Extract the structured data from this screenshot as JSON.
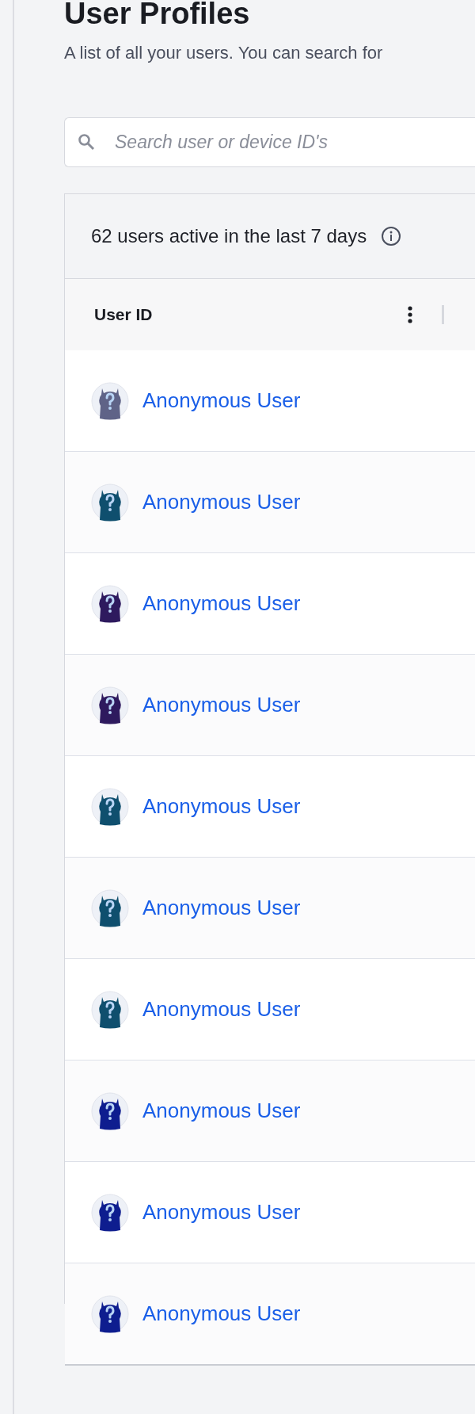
{
  "page": {
    "title": "User Profiles",
    "subtitle": "A list of all your users. You can search for"
  },
  "search": {
    "placeholder": "Search user or device ID's"
  },
  "table": {
    "summary": "62 users active in the last 7 days",
    "columns": [
      "User ID"
    ],
    "rows": [
      {
        "name": "Anonymous User",
        "color": "#5f6387"
      },
      {
        "name": "Anonymous User",
        "color": "#0f4f6e"
      },
      {
        "name": "Anonymous User",
        "color": "#2e1a5e"
      },
      {
        "name": "Anonymous User",
        "color": "#2e1a5e"
      },
      {
        "name": "Anonymous User",
        "color": "#0f4f6e"
      },
      {
        "name": "Anonymous User",
        "color": "#0f4f6e"
      },
      {
        "name": "Anonymous User",
        "color": "#0f4f6e"
      },
      {
        "name": "Anonymous User",
        "color": "#0e1d8f"
      },
      {
        "name": "Anonymous User",
        "color": "#0e1d8f"
      },
      {
        "name": "Anonymous User",
        "color": "#0e1d8f"
      }
    ]
  }
}
